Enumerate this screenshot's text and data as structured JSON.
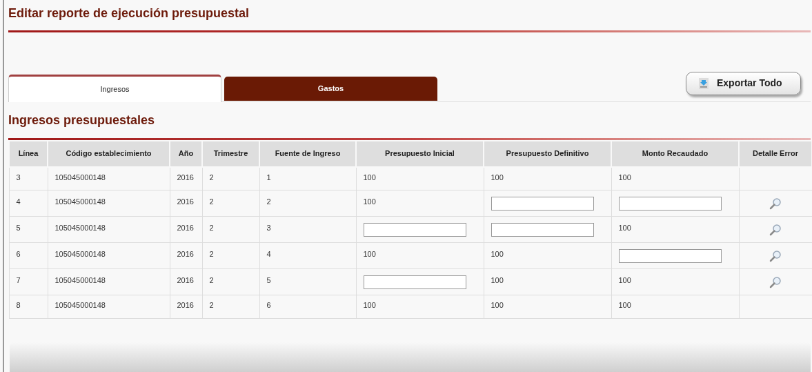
{
  "title": "Editar reporte de ejecución presupuestal",
  "tabs": [
    {
      "label": "Ingresos",
      "selected": true
    },
    {
      "label": "Gastos",
      "selected": false
    }
  ],
  "export_button": "Exportar Todo",
  "section_title": "Ingresos presupuestales",
  "table": {
    "columns": [
      "Línea",
      "Código establecimiento",
      "Año",
      "Trimestre",
      "Fuente de Ingreso",
      "Presupuesto Inicial",
      "Presupuesto Definitivo",
      "Monto Recaudado",
      "Detalle Error"
    ],
    "rows": [
      {
        "cells": [
          {
            "kind": "text",
            "text": "3"
          },
          {
            "kind": "text",
            "text": "105045000148"
          },
          {
            "kind": "text",
            "text": "2016"
          },
          {
            "kind": "text",
            "text": "2"
          },
          {
            "kind": "text",
            "text": "1"
          },
          {
            "kind": "text",
            "text": "100"
          },
          {
            "kind": "text",
            "text": "100"
          },
          {
            "kind": "text",
            "text": "100"
          }
        ],
        "error_detail": false
      },
      {
        "cells": [
          {
            "kind": "text",
            "text": "4"
          },
          {
            "kind": "text",
            "text": "105045000148"
          },
          {
            "kind": "text",
            "text": "2016"
          },
          {
            "kind": "text",
            "text": "2"
          },
          {
            "kind": "text",
            "text": "2"
          },
          {
            "kind": "text",
            "text": "100"
          },
          {
            "kind": "input"
          },
          {
            "kind": "input"
          }
        ],
        "error_detail": true
      },
      {
        "cells": [
          {
            "kind": "text",
            "text": "5"
          },
          {
            "kind": "text",
            "text": "105045000148"
          },
          {
            "kind": "text",
            "text": "2016"
          },
          {
            "kind": "text",
            "text": "2"
          },
          {
            "kind": "text",
            "text": "3"
          },
          {
            "kind": "input"
          },
          {
            "kind": "input"
          },
          {
            "kind": "text",
            "text": "100"
          }
        ],
        "error_detail": true
      },
      {
        "cells": [
          {
            "kind": "text",
            "text": "6"
          },
          {
            "kind": "text",
            "text": "105045000148"
          },
          {
            "kind": "text",
            "text": "2016"
          },
          {
            "kind": "text",
            "text": "2"
          },
          {
            "kind": "text",
            "text": "4"
          },
          {
            "kind": "text",
            "text": "100"
          },
          {
            "kind": "text",
            "text": "100"
          },
          {
            "kind": "input"
          }
        ],
        "error_detail": true
      },
      {
        "cells": [
          {
            "kind": "text",
            "text": "7"
          },
          {
            "kind": "text",
            "text": "105045000148"
          },
          {
            "kind": "text",
            "text": "2016"
          },
          {
            "kind": "text",
            "text": "2"
          },
          {
            "kind": "text",
            "text": "5"
          },
          {
            "kind": "input"
          },
          {
            "kind": "text",
            "text": "100"
          },
          {
            "kind": "text",
            "text": "100"
          }
        ],
        "error_detail": true
      },
      {
        "cells": [
          {
            "kind": "text",
            "text": "8"
          },
          {
            "kind": "text",
            "text": "105045000148"
          },
          {
            "kind": "text",
            "text": "2016"
          },
          {
            "kind": "text",
            "text": "2"
          },
          {
            "kind": "text",
            "text": "6"
          },
          {
            "kind": "text",
            "text": "100"
          },
          {
            "kind": "text",
            "text": "100"
          },
          {
            "kind": "text",
            "text": "100"
          }
        ],
        "error_detail": false
      }
    ]
  }
}
